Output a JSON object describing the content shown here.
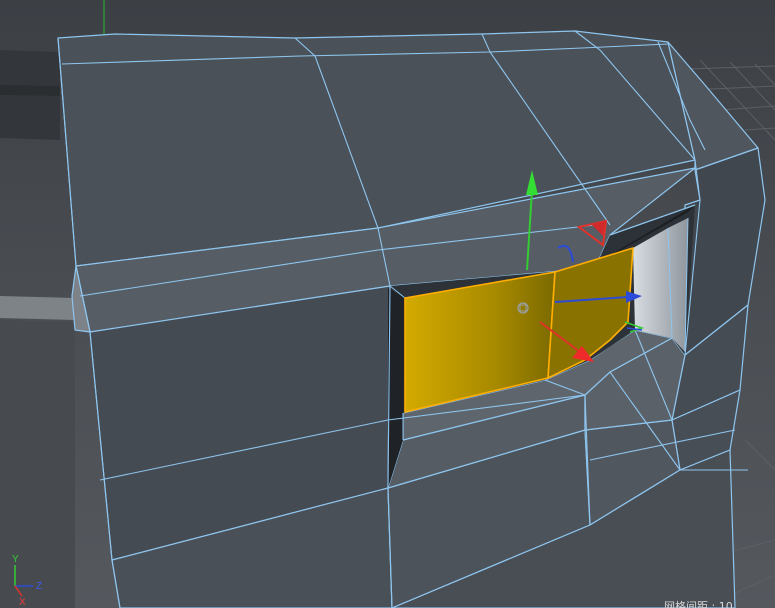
{
  "viewport": {
    "status_text": "网格间距 : 10 ...",
    "axis_labels": {
      "y": "Y",
      "z": "Z",
      "x": "X"
    }
  },
  "icons": {
    "move_gizmo": "move-gizmo-icon",
    "rotate_gizmo": "rotate-gizmo-icon",
    "scale_gizmo": "scale-gizmo-icon",
    "object_axis": "object-axis-icon",
    "view_axis": "view-axis-indicator-icon"
  },
  "colors": {
    "viewport_bg": "#4d5257",
    "mesh_face": "#4f555d",
    "mesh_edge": "#8ec5ee",
    "selection_fill": "#c9a200",
    "selection_edge": "#ffae00",
    "axis_x": "#e0322b",
    "axis_y": "#33cc33",
    "axis_z": "#2b4bd8"
  }
}
